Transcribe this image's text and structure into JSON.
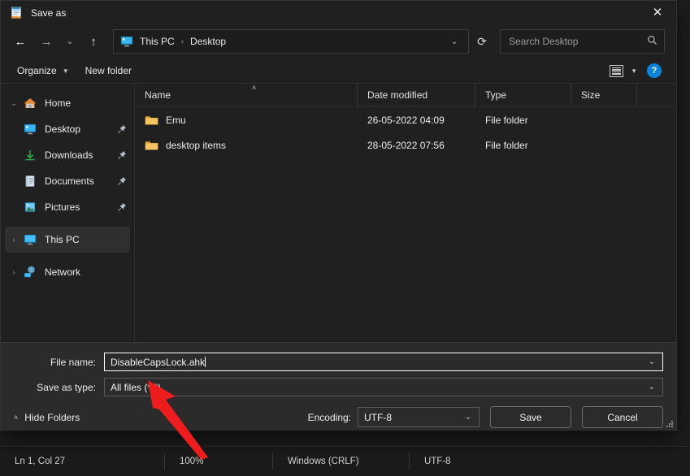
{
  "background_app": {
    "statusbar": {
      "cursor_position": "Ln 1, Col 27",
      "zoom": "100%",
      "line_ending": "Windows (CRLF)",
      "encoding": "UTF-8"
    }
  },
  "dialog": {
    "title": "Save as",
    "title_icon": "notepad-icon",
    "close_label": "✕",
    "nav": {
      "back": "←",
      "forward": "→",
      "recent": "⌄",
      "up": "↑"
    },
    "address": {
      "icon": "desktop-icon",
      "crumbs": [
        "This PC",
        "Desktop"
      ],
      "separator": "›",
      "dropdown": "⌄"
    },
    "refresh_label": "⟳",
    "search": {
      "placeholder": "Search Desktop",
      "value": "",
      "icon": "search-icon"
    },
    "commandbar": {
      "organize": "Organize",
      "organize_caret": "▼",
      "new_folder": "New folder",
      "view_icon": "list-view-icon",
      "view_caret": "▼",
      "help": "?"
    },
    "sidebar": {
      "items": [
        {
          "label": "Home",
          "icon": "home-icon",
          "chevron": "⌄",
          "indent": false,
          "pinned": false,
          "selected": false
        },
        {
          "label": "Desktop",
          "icon": "desktop-icon",
          "chevron": "",
          "indent": true,
          "pinned": true,
          "selected": false
        },
        {
          "label": "Downloads",
          "icon": "downloads-icon",
          "chevron": "",
          "indent": true,
          "pinned": true,
          "selected": false
        },
        {
          "label": "Documents",
          "icon": "documents-icon",
          "chevron": "",
          "indent": true,
          "pinned": true,
          "selected": false
        },
        {
          "label": "Pictures",
          "icon": "pictures-icon",
          "chevron": "",
          "indent": true,
          "pinned": true,
          "selected": false
        },
        {
          "label": "This PC",
          "icon": "this-pc-icon",
          "chevron": "›",
          "indent": false,
          "pinned": false,
          "selected": true
        },
        {
          "label": "Network",
          "icon": "network-icon",
          "chevron": "›",
          "indent": false,
          "pinned": false,
          "selected": false
        }
      ]
    },
    "filelist": {
      "columns": [
        "Name",
        "Date modified",
        "Type",
        "Size"
      ],
      "sort_indicator": "˄",
      "sort_column": "Name",
      "rows": [
        {
          "name": "Emu",
          "date_modified": "26-05-2022 04:09",
          "type": "File folder",
          "size": "",
          "icon": "folder-icon"
        },
        {
          "name": "desktop items",
          "date_modified": "28-05-2022 07:56",
          "type": "File folder",
          "size": "",
          "icon": "folder-icon"
        }
      ]
    },
    "form": {
      "file_name_label": "File name:",
      "file_name_value": "DisableCapsLock.ahk",
      "save_as_type_label": "Save as type:",
      "save_as_type_value": "All files  (*.*)",
      "combo_caret": "⌄"
    },
    "footer": {
      "hide_folders": "Hide Folders",
      "hide_folders_caret": "˄",
      "encoding_label": "Encoding:",
      "encoding_value": "UTF-8",
      "encoding_caret": "⌄",
      "save_label": "Save",
      "cancel_label": "Cancel"
    }
  },
  "annotation": {
    "type": "arrow",
    "color": "#ee1c1c",
    "points_at": "save-as-type-combo"
  },
  "colors": {
    "window_bg": "#202020",
    "form_bg": "#2b2b2b",
    "accent": "#0a84d8",
    "text": "#ececec",
    "annotation_red": "#ee1c1c"
  }
}
